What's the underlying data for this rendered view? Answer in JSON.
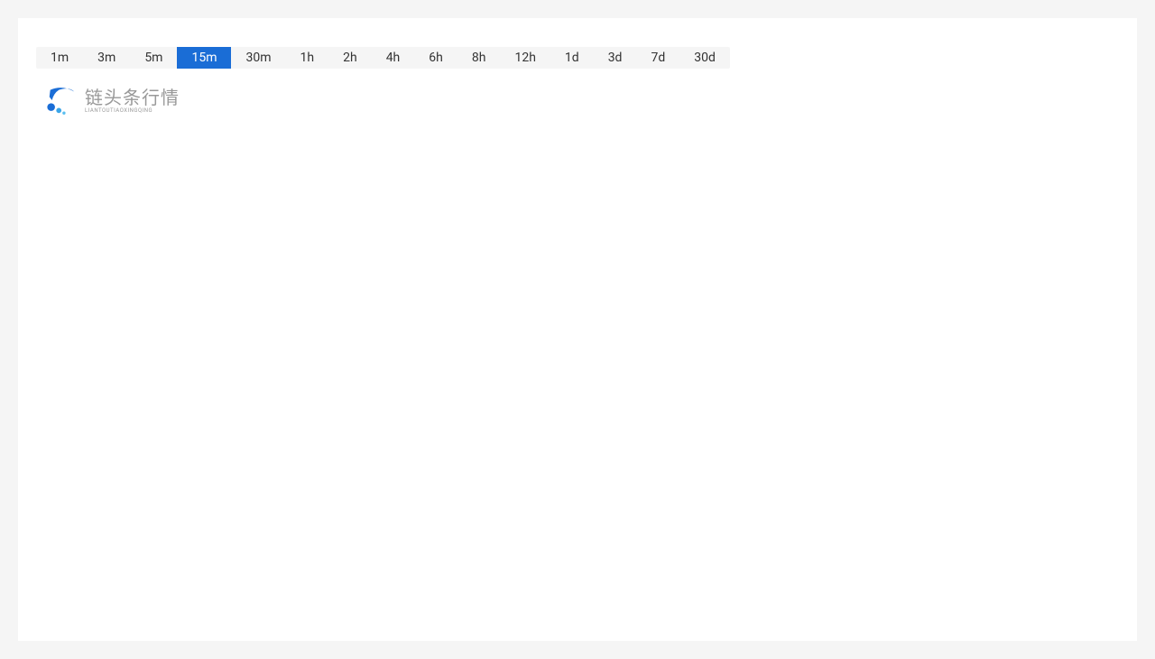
{
  "intervals": [
    {
      "label": "1m",
      "active": false
    },
    {
      "label": "3m",
      "active": false
    },
    {
      "label": "5m",
      "active": false
    },
    {
      "label": "15m",
      "active": true
    },
    {
      "label": "30m",
      "active": false
    },
    {
      "label": "1h",
      "active": false
    },
    {
      "label": "2h",
      "active": false
    },
    {
      "label": "4h",
      "active": false
    },
    {
      "label": "6h",
      "active": false
    },
    {
      "label": "8h",
      "active": false
    },
    {
      "label": "12h",
      "active": false
    },
    {
      "label": "1d",
      "active": false
    },
    {
      "label": "3d",
      "active": false
    },
    {
      "label": "7d",
      "active": false
    },
    {
      "label": "30d",
      "active": false
    }
  ],
  "logo": {
    "title": "链头条行情",
    "subtitle": "LIANTOUTIAOXINGQING"
  }
}
